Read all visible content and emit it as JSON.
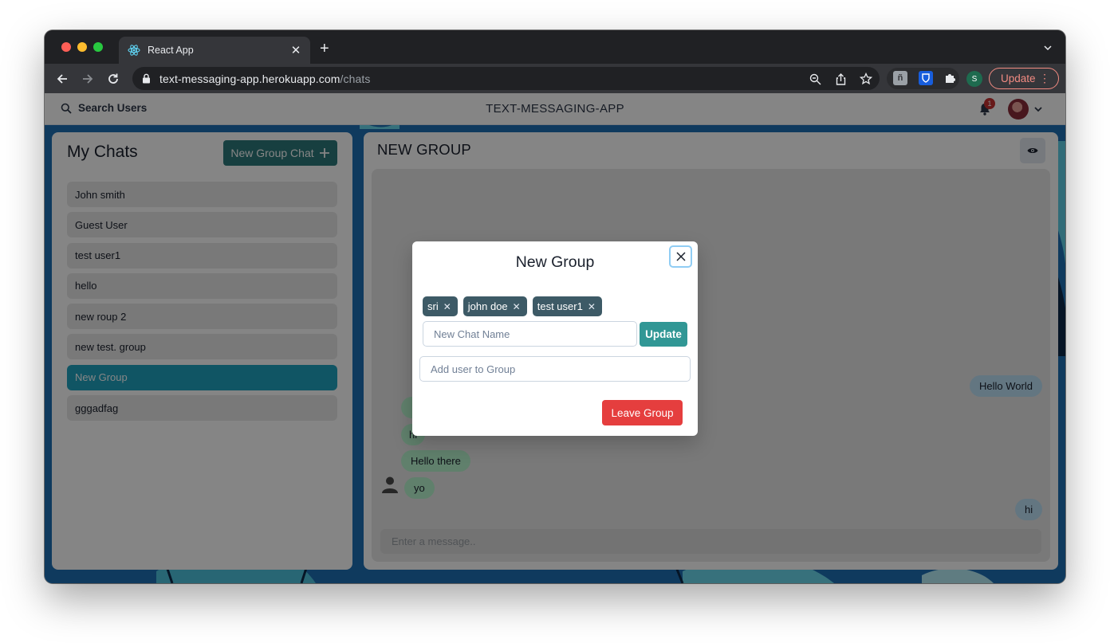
{
  "browser": {
    "tab_title": "React App",
    "url_host": "text-messaging-app.herokuapp.com",
    "url_path": "/chats",
    "update_label": "Update",
    "profile_initial": "S"
  },
  "header": {
    "search_label": "Search Users",
    "app_title": "TEXT-MESSAGING-APP",
    "notification_count": "1"
  },
  "my_chats": {
    "title": "My Chats",
    "new_group_label": "New Group Chat",
    "items": [
      {
        "label": "John smith"
      },
      {
        "label": "Guest User"
      },
      {
        "label": "test user1"
      },
      {
        "label": "hello"
      },
      {
        "label": "new roup 2"
      },
      {
        "label": "new test. group"
      },
      {
        "label": "New Group",
        "active": true
      },
      {
        "label": "gggadfag"
      }
    ]
  },
  "chat": {
    "title": "NEW GROUP",
    "messages": [
      {
        "text": "Hello World",
        "side": "sent"
      },
      {
        "text": "hi",
        "side": "recv"
      },
      {
        "text": "Hello there",
        "side": "recv"
      },
      {
        "text": "yo",
        "side": "recv"
      },
      {
        "text": "hi",
        "side": "sent"
      }
    ],
    "input_placeholder": "Enter a message.."
  },
  "modal": {
    "title": "New Group",
    "members": [
      "sri",
      "john doe",
      "test user1"
    ],
    "chat_name_placeholder": "New Chat Name",
    "update_label": "Update",
    "add_user_placeholder": "Add user to Group",
    "leave_label": "Leave Group"
  },
  "colors": {
    "accent_teal": "#2c7a7b",
    "active_chat": "#1fa3c0",
    "sent_bubble": "#bee3f8",
    "recv_bubble": "#b9f5d0",
    "leave_red": "#e53e3e",
    "tag_bg": "#3d5a66"
  }
}
